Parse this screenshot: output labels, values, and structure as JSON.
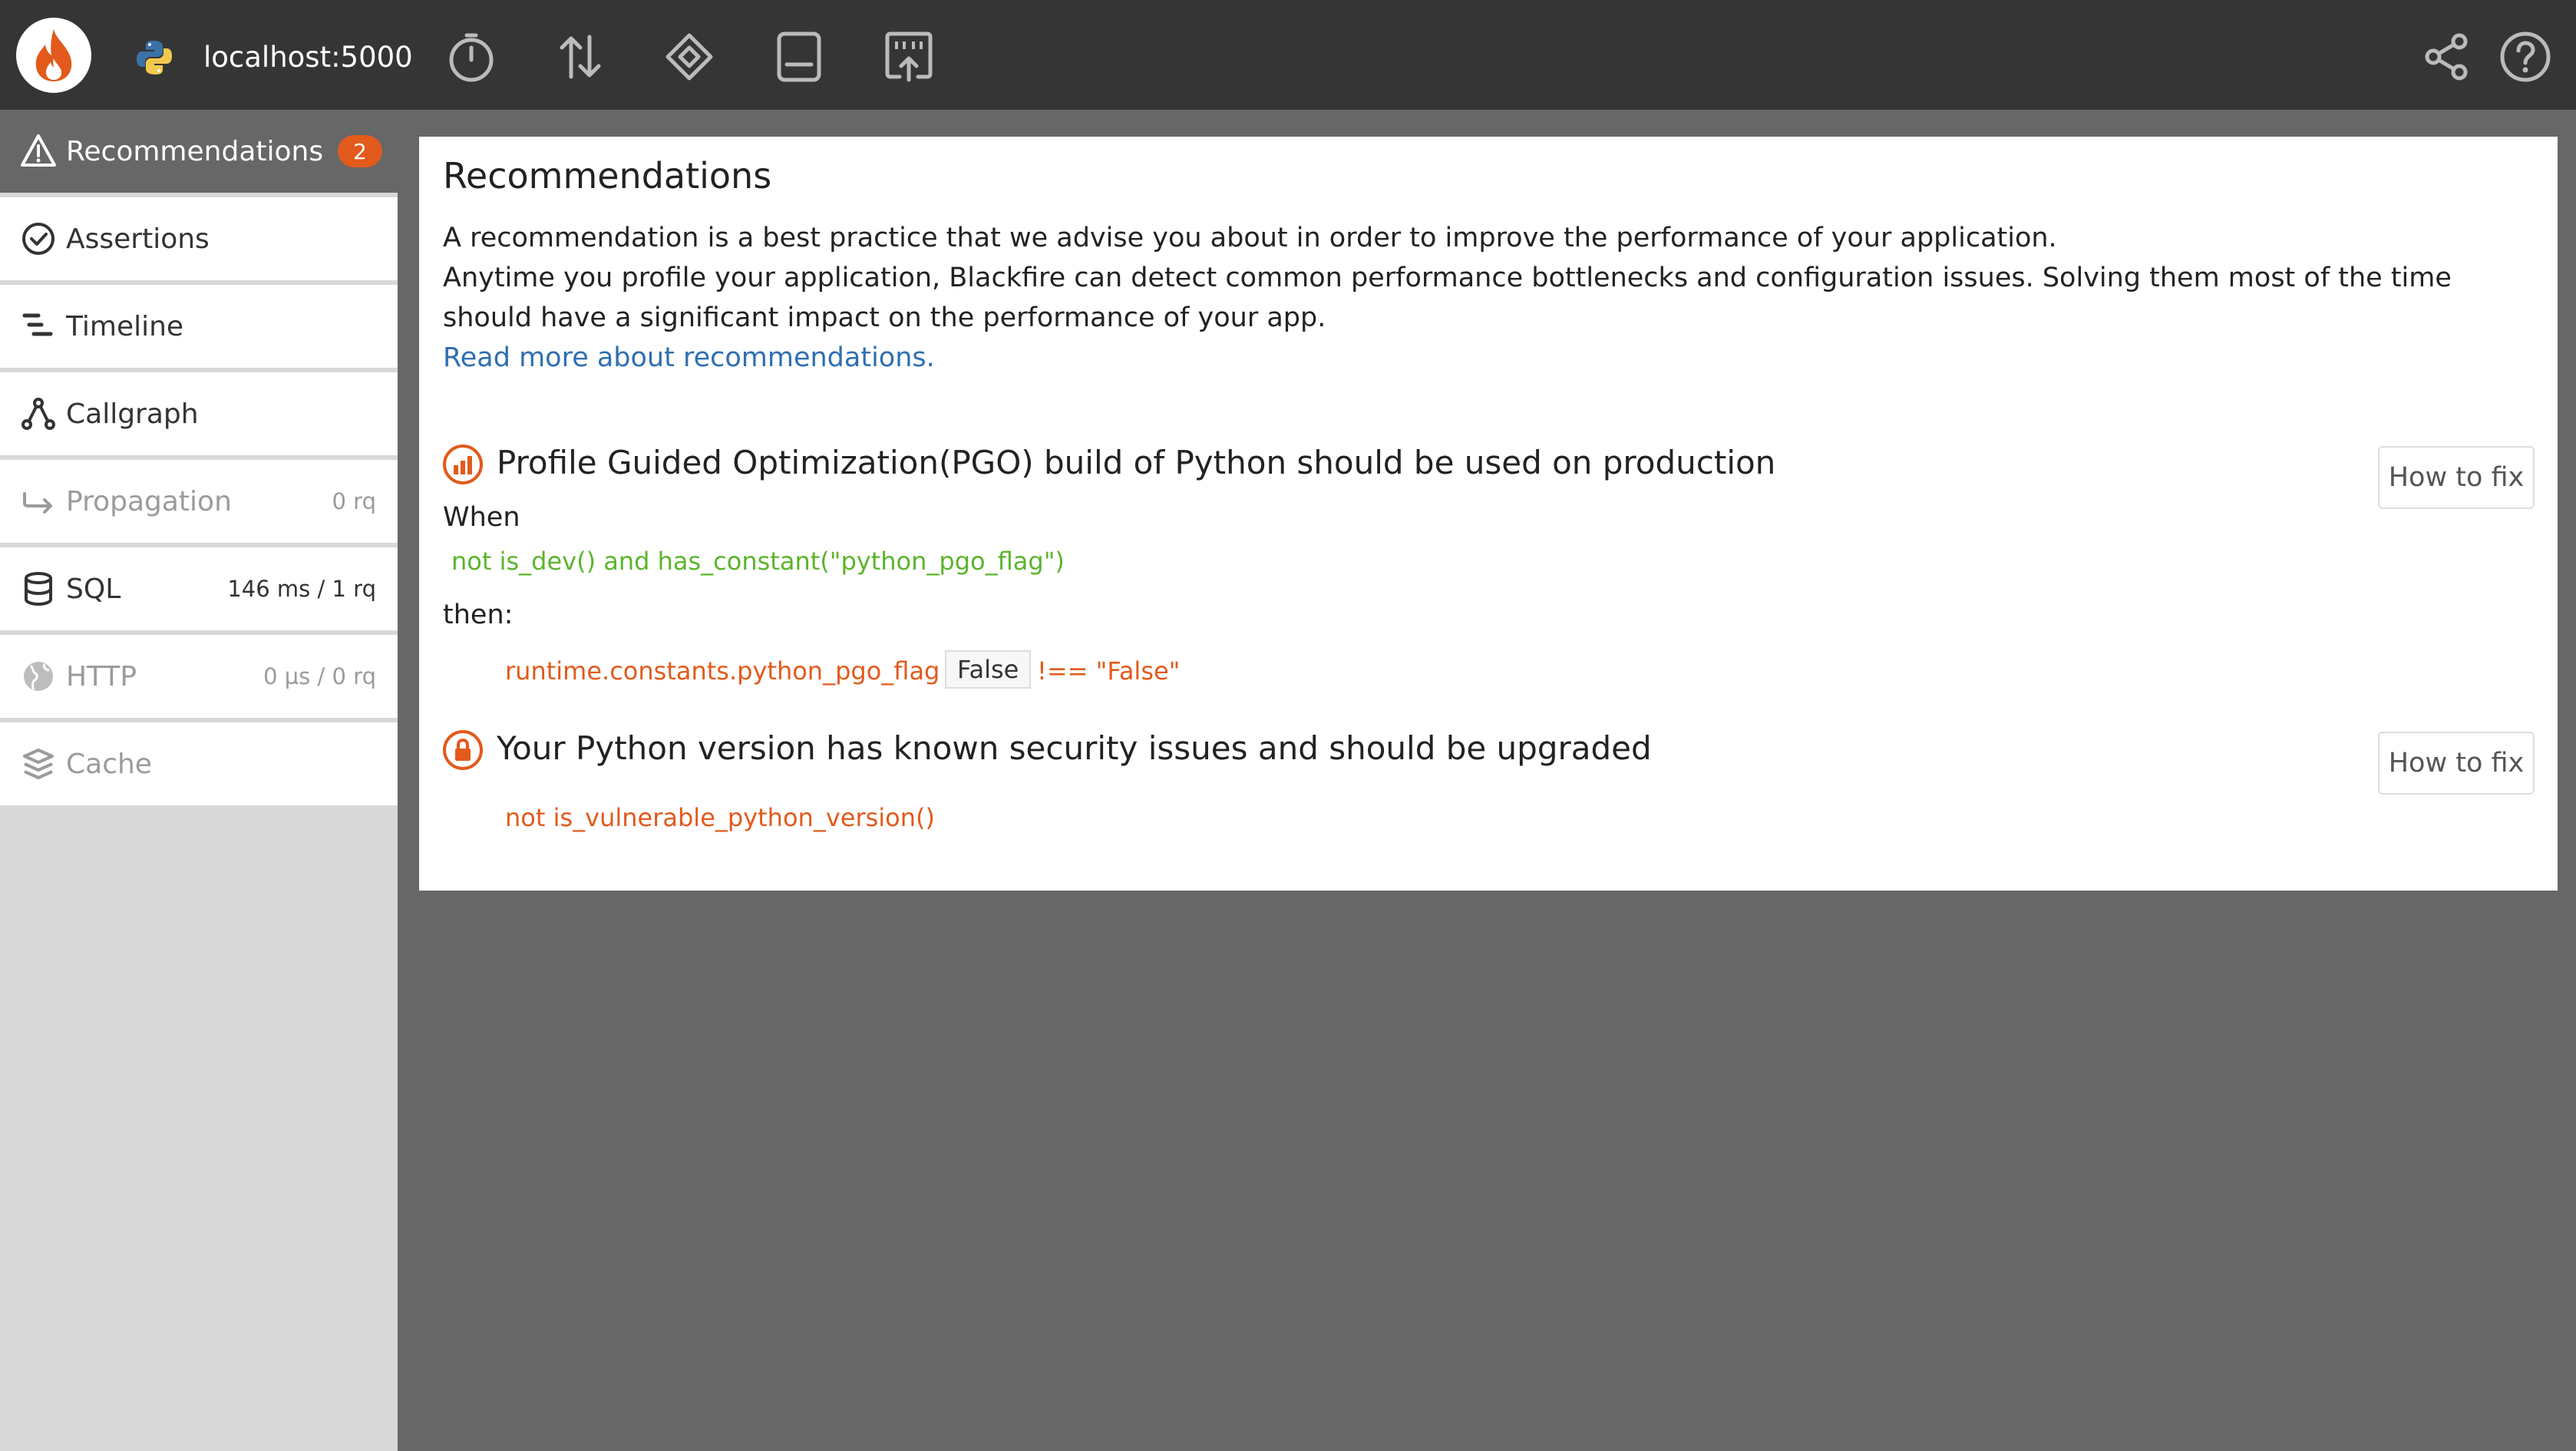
{
  "topbar": {
    "host": "localhost:5000",
    "icons": [
      "timer-icon",
      "transfer-icon",
      "cpu-icon",
      "memory-icon",
      "network-io-icon"
    ],
    "right_icons": [
      "share-icon",
      "help-icon"
    ]
  },
  "sidebar": {
    "items": [
      {
        "label": "Recommendations",
        "badge": "2",
        "icon": "warning-icon"
      },
      {
        "label": "Assertions",
        "icon": "check-circle-icon"
      },
      {
        "label": "Timeline",
        "icon": "timeline-icon"
      },
      {
        "label": "Callgraph",
        "icon": "callgraph-icon"
      },
      {
        "label": "Propagation",
        "meta": "0 rq",
        "icon": "propagation-icon"
      },
      {
        "label": "SQL",
        "meta": "146 ms / 1 rq",
        "icon": "database-icon"
      },
      {
        "label": "HTTP",
        "meta": "0 µs / 0 rq",
        "icon": "globe-icon"
      },
      {
        "label": "Cache",
        "icon": "layers-icon"
      }
    ]
  },
  "main": {
    "title": "Recommendations",
    "desc1": "A recommendation is a best practice that we advise you about in order to improve the performance of your application.",
    "desc2": "Anytime you profile your application, Blackfire can detect common performance bottlenecks and configuration issues. Solving them most of the time should have a significant impact on the performance of your app.",
    "link": "Read more about recommendations.",
    "recommendations": [
      {
        "title": "Profile Guided Optimization(PGO) build of Python should be used on production",
        "fix": "How to fix",
        "when_label": "When",
        "when_expr": "not is_dev() and has_constant(\"python_pgo_flag\")",
        "then_label": "then:",
        "assert_metric": "runtime.constants.python_pgo_flag",
        "assert_value": "False",
        "assert_cond": "!== \"False\""
      },
      {
        "title": "Your Python version has known security issues and should be upgraded",
        "fix": "How to fix",
        "assert_expr": "not is_vulnerable_python_version()"
      }
    ],
    "colors": {
      "accent": "#e25a1c",
      "green": "#5bb52b",
      "link": "#2f6fb1"
    }
  }
}
